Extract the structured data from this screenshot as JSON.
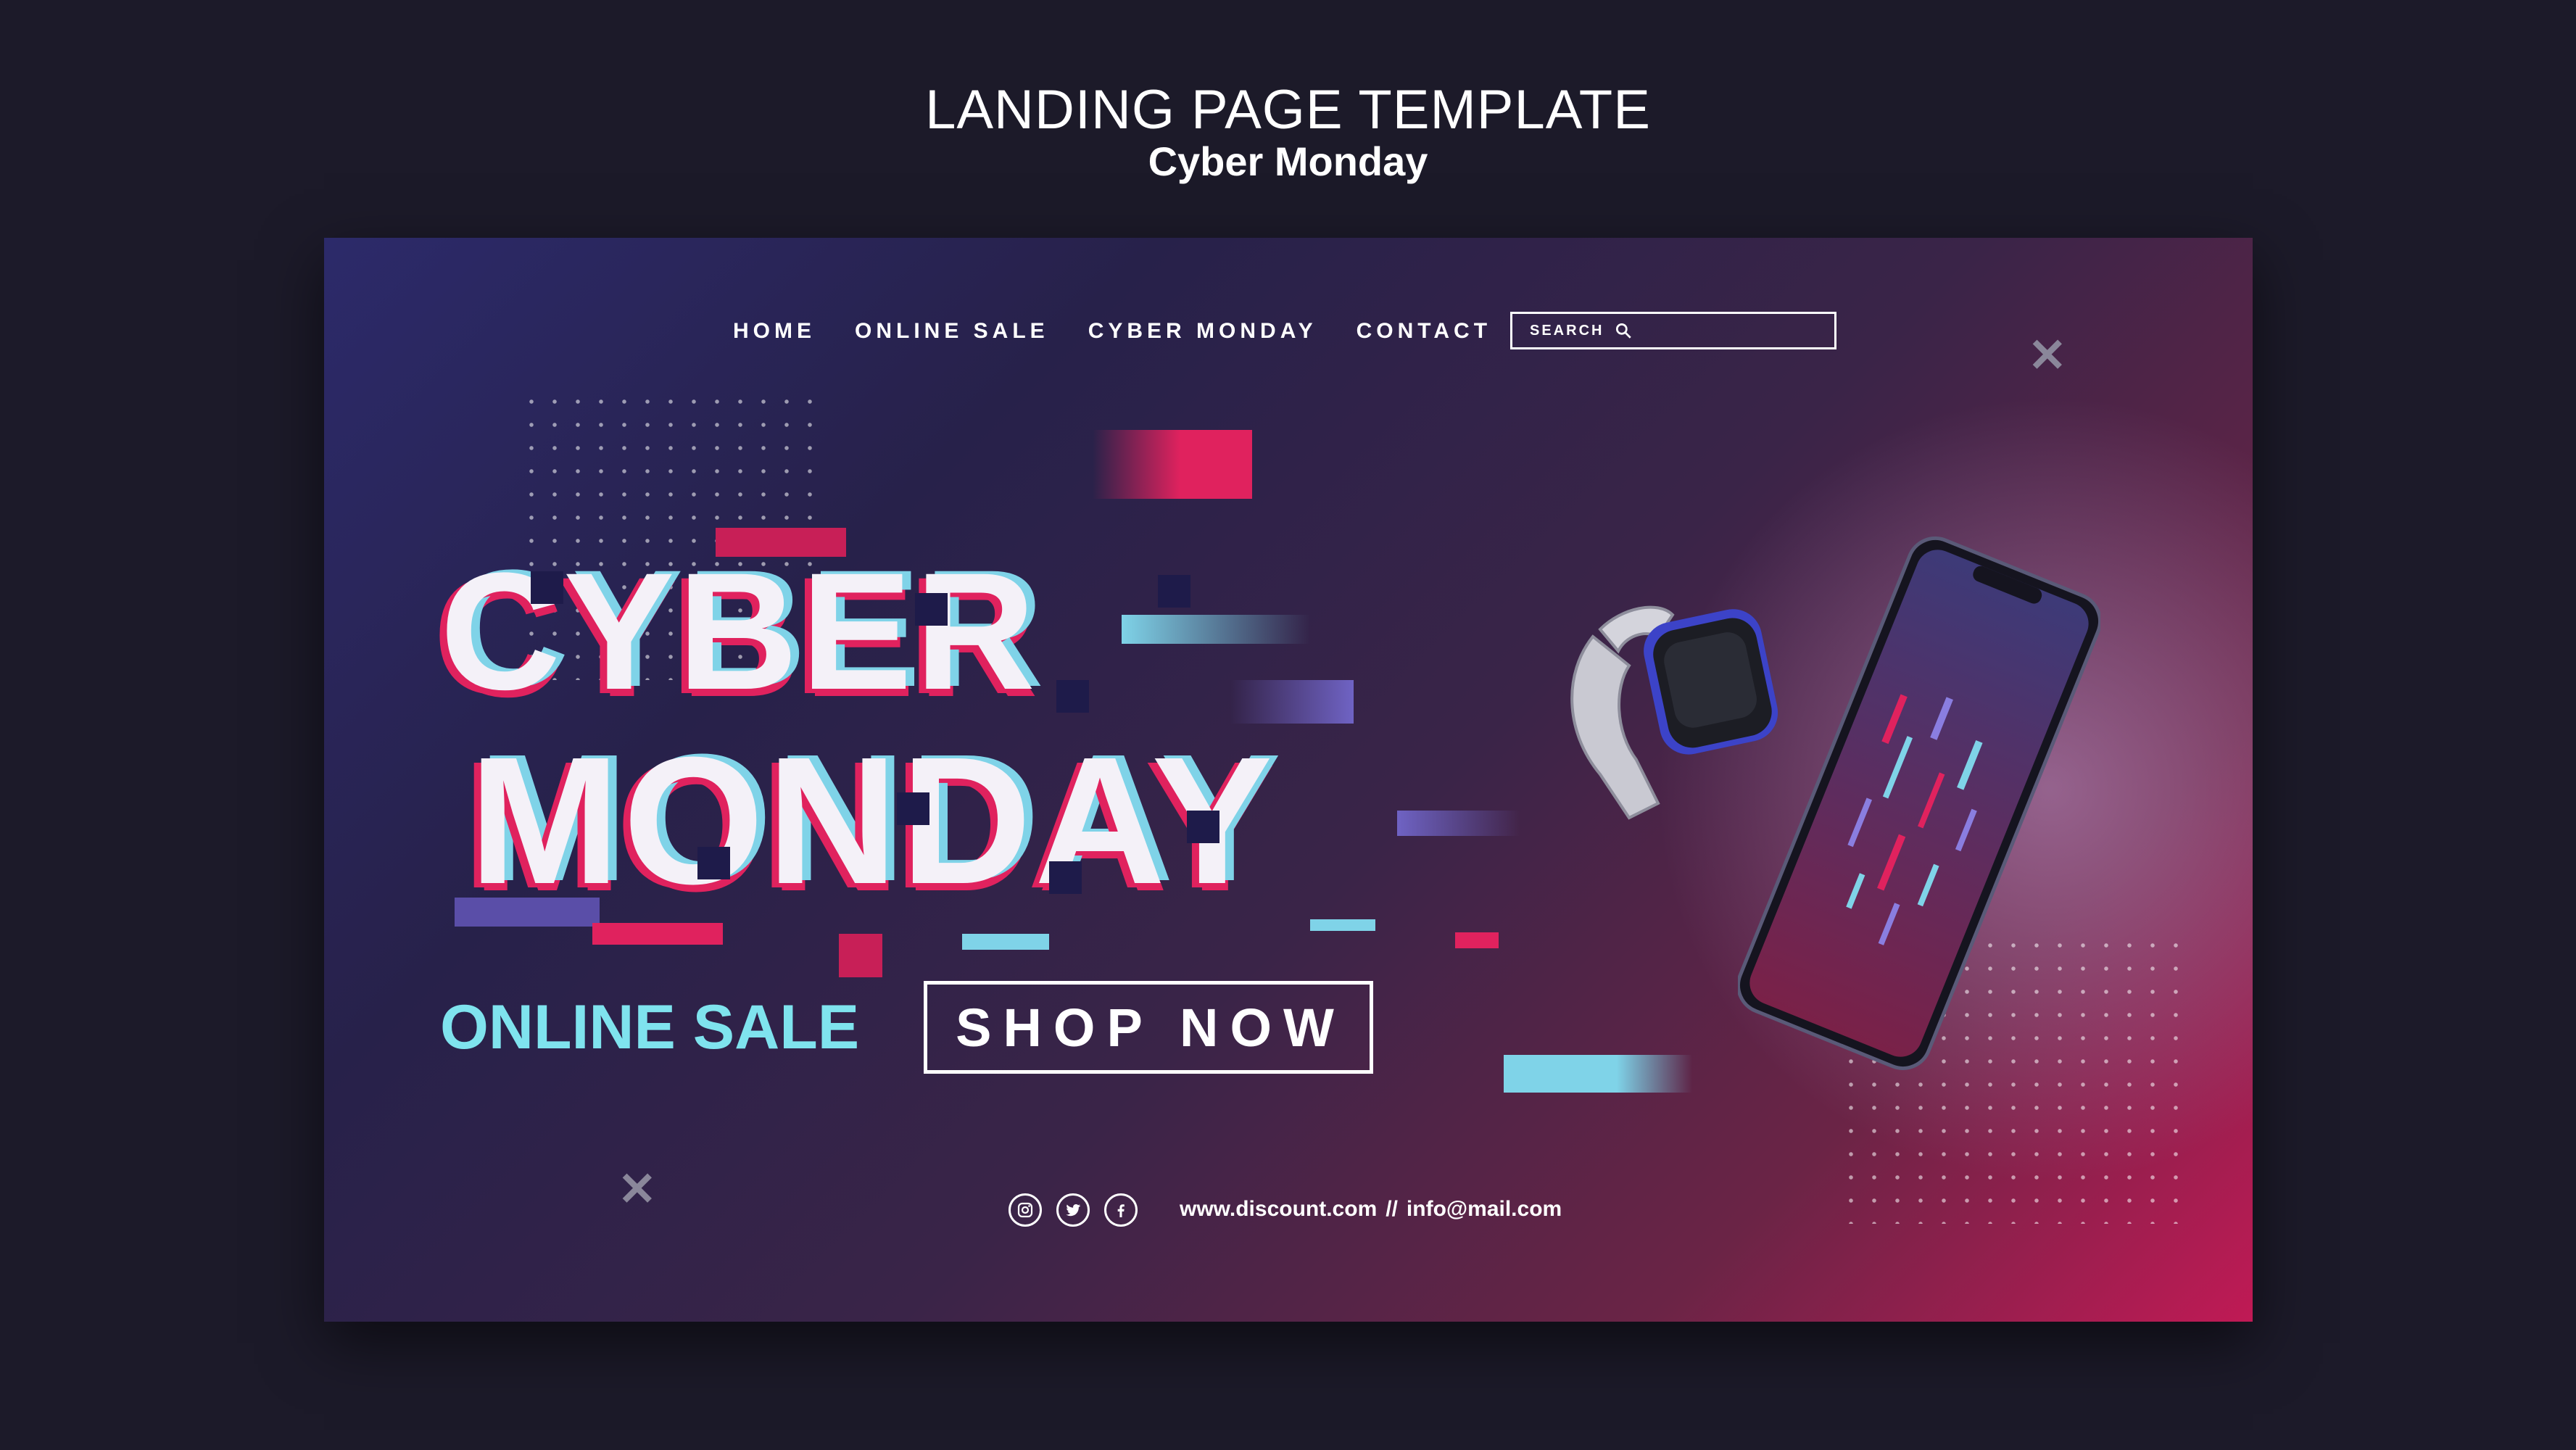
{
  "header": {
    "title": "LANDING PAGE TEMPLATE",
    "subtitle": "Cyber Monday"
  },
  "nav": {
    "items": [
      {
        "label": "HOME"
      },
      {
        "label": "ONLINE SALE"
      },
      {
        "label": "CYBER MONDAY"
      },
      {
        "label": "CONTACT"
      }
    ]
  },
  "search": {
    "placeholder": "SEARCH",
    "icon": "search-icon"
  },
  "hero": {
    "headline_line1": "CYBER",
    "headline_line2": "MONDAY",
    "tagline": "ONLINE SALE",
    "cta_label": "SHOP NOW"
  },
  "footer": {
    "socials": [
      {
        "icon": "instagram-icon"
      },
      {
        "icon": "twitter-icon"
      },
      {
        "icon": "facebook-icon"
      }
    ],
    "website": "www.discount.com",
    "separator": "//",
    "email": "info@mail.com"
  },
  "colors": {
    "page_background": "#1c1a29",
    "accent_pink": "#e0225e",
    "accent_cyan": "#7fe3ee",
    "text": "#ffffff"
  }
}
